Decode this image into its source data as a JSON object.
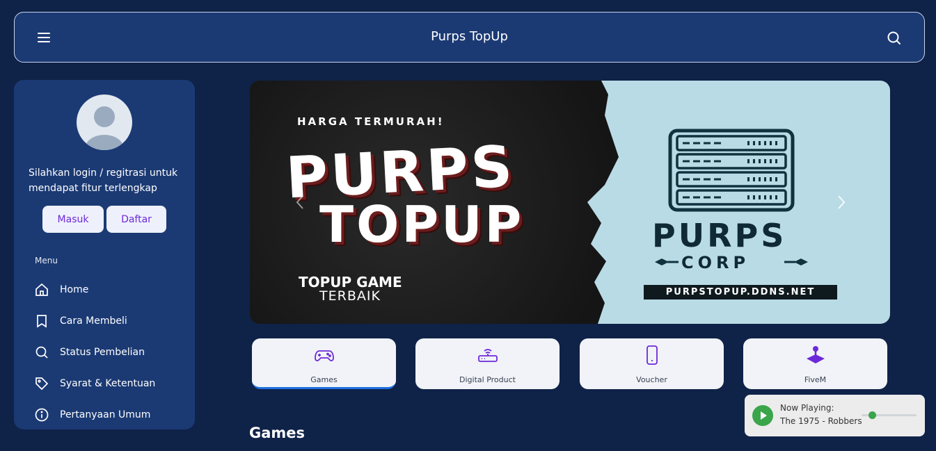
{
  "header": {
    "title": "Purps TopUp",
    "menu_icon": "hamburger-icon",
    "search_icon": "search-icon"
  },
  "sidebar": {
    "login_text": "Silahkan login / regitrasi untuk mendapat fitur terlengkap",
    "login_button": "Masuk",
    "register_button": "Daftar",
    "menu_heading": "Menu",
    "items": [
      {
        "label": "Home",
        "icon": "home-icon"
      },
      {
        "label": "Cara Membeli",
        "icon": "bookmark-icon"
      },
      {
        "label": "Status Pembelian",
        "icon": "search-icon"
      },
      {
        "label": "Syarat & Ketentuan",
        "icon": "tag-icon"
      },
      {
        "label": "Pertanyaan Umum",
        "icon": "info-icon"
      }
    ]
  },
  "banner": {
    "tagline": "HARGA TERMURAH!",
    "line1": "PURPS",
    "line2": "TOPUP",
    "sub1": "TOPUP GAME",
    "sub2": "TERBAIK",
    "corp_name": "PURPS",
    "corp_sub": "CORP",
    "corp_url": "PURPSTOPUP.DDNS.NET"
  },
  "categories": [
    {
      "label": "Games",
      "icon": "gamepad-icon",
      "active": true
    },
    {
      "label": "Digital Product",
      "icon": "router-icon",
      "active": false
    },
    {
      "label": "Voucher",
      "icon": "phone-icon",
      "active": false
    },
    {
      "label": "FiveM",
      "icon": "joystick-icon",
      "active": false
    }
  ],
  "section_title": "Games",
  "player": {
    "now_playing_label": "Now Playing:",
    "song": "The 1975 - Robbers",
    "progress": 0.2
  },
  "colors": {
    "background": "#0f2248",
    "panel": "#1b3a74",
    "accent": "#6d28d9",
    "play": "#3aa54a"
  }
}
